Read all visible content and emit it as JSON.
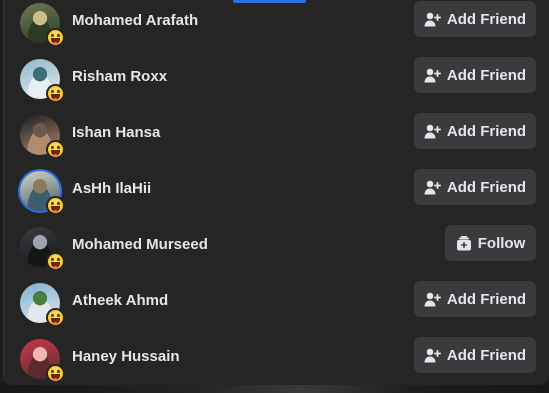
{
  "friend_suggestions": [
    {
      "name": "Mohamed Arafath",
      "action": "Add Friend",
      "action_type": "add",
      "reaction": "laughing-emoji",
      "avatar_colors": [
        "#6d7b53",
        "#c9c08a",
        "#2d3a26"
      ]
    },
    {
      "name": "Risham Roxx",
      "action": "Add Friend",
      "action_type": "add",
      "reaction": "laughing-emoji",
      "avatar_colors": [
        "#8fb6c9",
        "#3c6f7a",
        "#e8eef2"
      ]
    },
    {
      "name": "Ishan Hansa",
      "action": "Add Friend",
      "action_type": "add",
      "reaction": "laughing-emoji",
      "avatar_colors": [
        "#1e1f24",
        "#6a5a4e",
        "#b28a6c"
      ]
    },
    {
      "name": "AsHh IlaHii",
      "action": "Add Friend",
      "action_type": "add",
      "reaction": "laughing-emoji",
      "avatar_colors": [
        "#d9d4c6",
        "#8c7b62",
        "#3f5e6b"
      ]
    },
    {
      "name": "Mohamed Murseed",
      "action": "Follow",
      "action_type": "follow",
      "reaction": "laughing-emoji",
      "avatar_colors": [
        "#3b3d44",
        "#9ea3ad",
        "#151517"
      ]
    },
    {
      "name": "Atheek Ahmd",
      "action": "Add Friend",
      "action_type": "add",
      "reaction": "laughing-emoji",
      "avatar_colors": [
        "#7fb0d6",
        "#4a7f3d",
        "#e3e8ec"
      ]
    },
    {
      "name": "Haney Hussain",
      "action": "Add Friend",
      "action_type": "add",
      "reaction": "laughing-emoji",
      "avatar_colors": [
        "#c93a4a",
        "#f2b7b2",
        "#5a2b2e"
      ]
    }
  ],
  "accent_color": "#2d6fe1"
}
